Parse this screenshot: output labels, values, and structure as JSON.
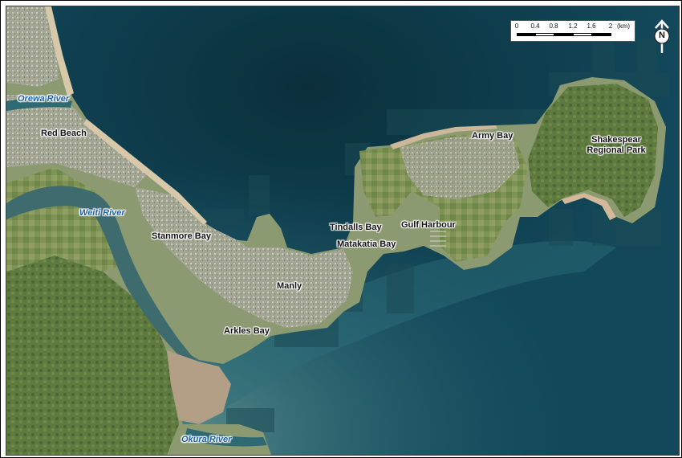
{
  "map": {
    "colors": {
      "sea_deep": "#0c3440",
      "sea": "#15505e",
      "sea_shallow": "#2f7180",
      "land": "#8f9d78",
      "urban": "#9a9e8e",
      "park": "#6e8c4c",
      "beach": "#c9b498",
      "river_label": "#1b5fa8"
    },
    "places": [
      {
        "name": "Red Beach"
      },
      {
        "name": "Stanmore Bay"
      },
      {
        "name": "Manly"
      },
      {
        "name": "Arkles Bay"
      },
      {
        "name": "Tindalls Bay"
      },
      {
        "name": "Matakatia Bay"
      },
      {
        "name": "Gulf Harbour"
      },
      {
        "name": "Army Bay"
      },
      {
        "name": "Shakespear"
      },
      {
        "name": "Regional Park"
      }
    ],
    "rivers": [
      {
        "name": "Orewa River"
      },
      {
        "name": "Weiti River"
      },
      {
        "name": "Okura River"
      }
    ],
    "scale_bar": {
      "ticks": [
        "0",
        "0.4",
        "0.8",
        "1.2",
        "1.6",
        "2"
      ],
      "unit": "(km)"
    },
    "north_arrow": {
      "letter": "N",
      "icon": "north-arrow-icon"
    }
  }
}
